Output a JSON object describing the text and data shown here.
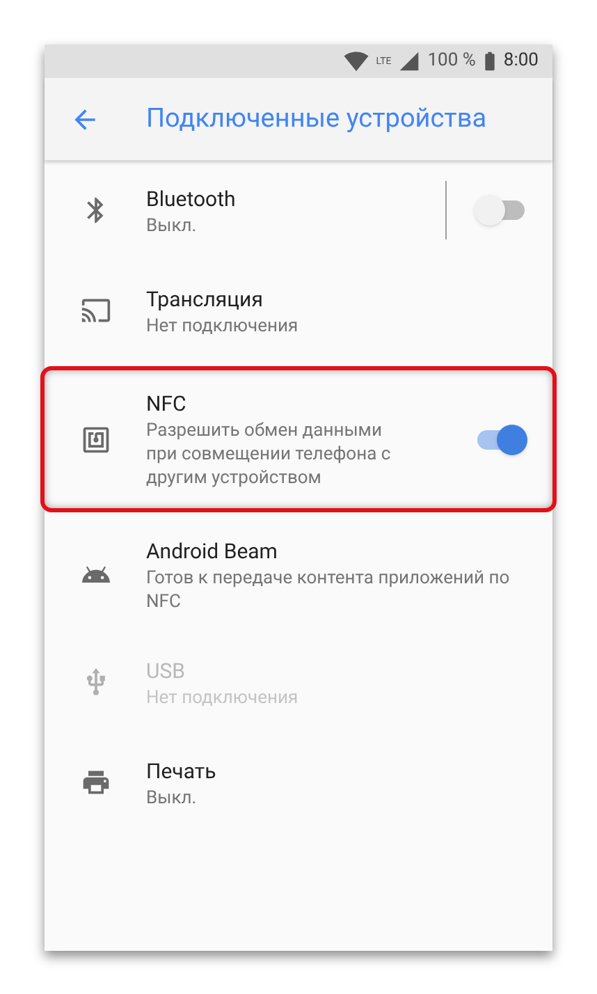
{
  "status_bar": {
    "network": "LTE",
    "battery": "100 %",
    "time": "8:00"
  },
  "toolbar": {
    "title": "Подключенные устройства"
  },
  "items": [
    {
      "kind": "switch",
      "title": "Bluetooth",
      "subtitle": "Выкл.",
      "on": false,
      "disabled": false,
      "highlighted": false
    },
    {
      "kind": "plain",
      "title": "Трансляция",
      "subtitle": "Нет подключения",
      "disabled": false,
      "highlighted": false
    },
    {
      "kind": "switch",
      "title": "NFC",
      "subtitle": "Разрешить обмен данными при совмещении телефона с другим устройством",
      "on": true,
      "disabled": false,
      "highlighted": true
    },
    {
      "kind": "plain",
      "title": "Android Beam",
      "subtitle": "Готов к передаче контента приложений по NFC",
      "disabled": false,
      "highlighted": false
    },
    {
      "kind": "plain",
      "title": "USB",
      "subtitle": "Нет подключения",
      "disabled": true,
      "highlighted": false
    },
    {
      "kind": "plain",
      "title": "Печать",
      "subtitle": "Выкл.",
      "disabled": false,
      "highlighted": false
    }
  ]
}
